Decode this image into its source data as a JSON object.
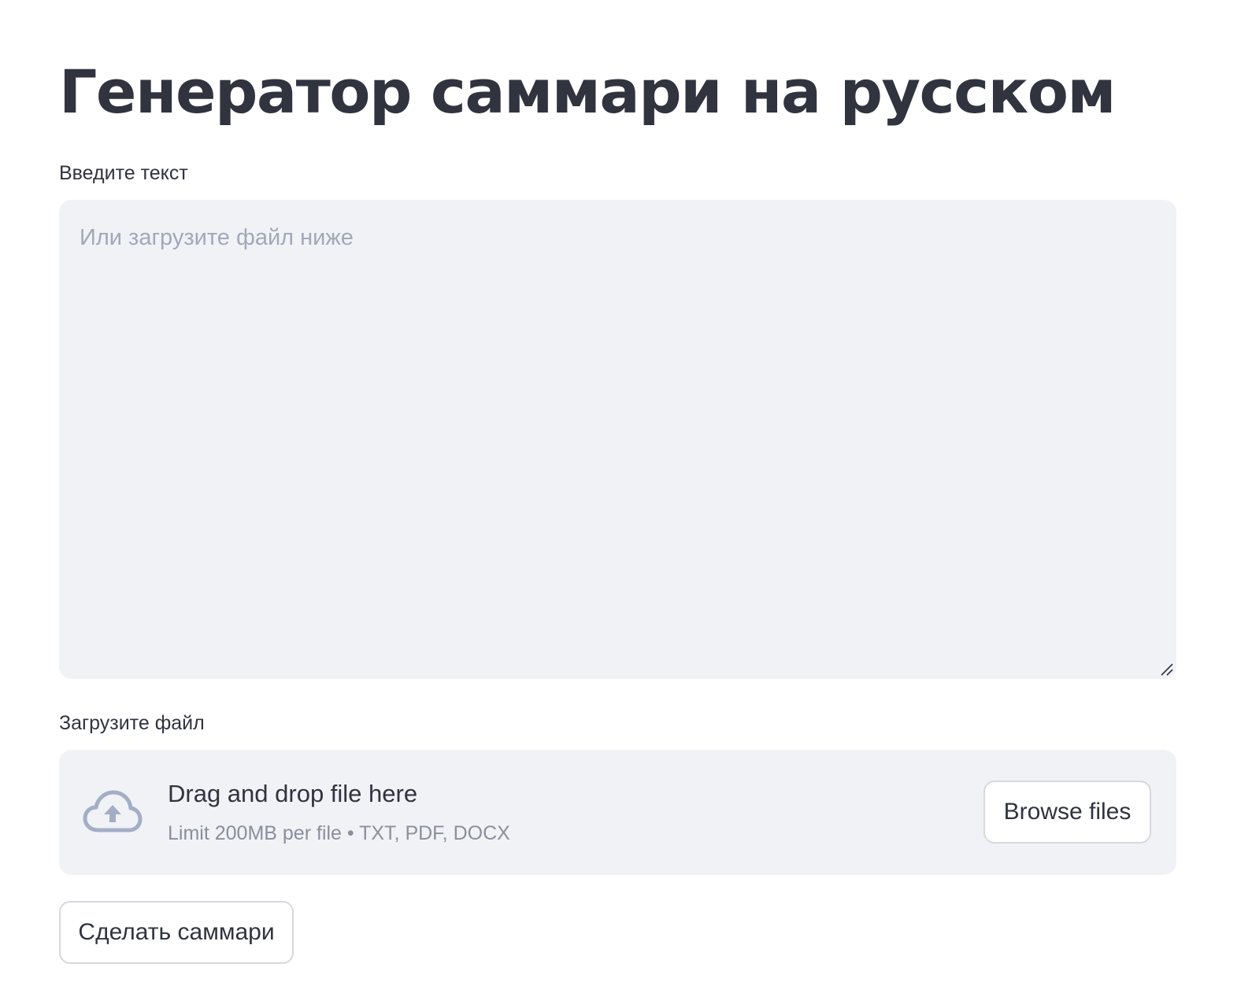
{
  "page": {
    "title": "Генератор саммари на русском"
  },
  "text_input": {
    "label": "Введите текст",
    "placeholder": "Или загрузите файл ниже",
    "value": ""
  },
  "file_uploader": {
    "label": "Загрузите файл",
    "dropzone_title": "Drag and drop file here",
    "dropzone_hint": "Limit 200MB per file • TXT, PDF, DOCX",
    "browse_label": "Browse files",
    "icon": "cloud-upload-icon"
  },
  "actions": {
    "summarize_label": "Сделать саммари"
  },
  "colors": {
    "text": "#31333f",
    "input_background": "#f0f2f6",
    "icon": "#a3aec6",
    "button_border": "#d6d8de"
  }
}
